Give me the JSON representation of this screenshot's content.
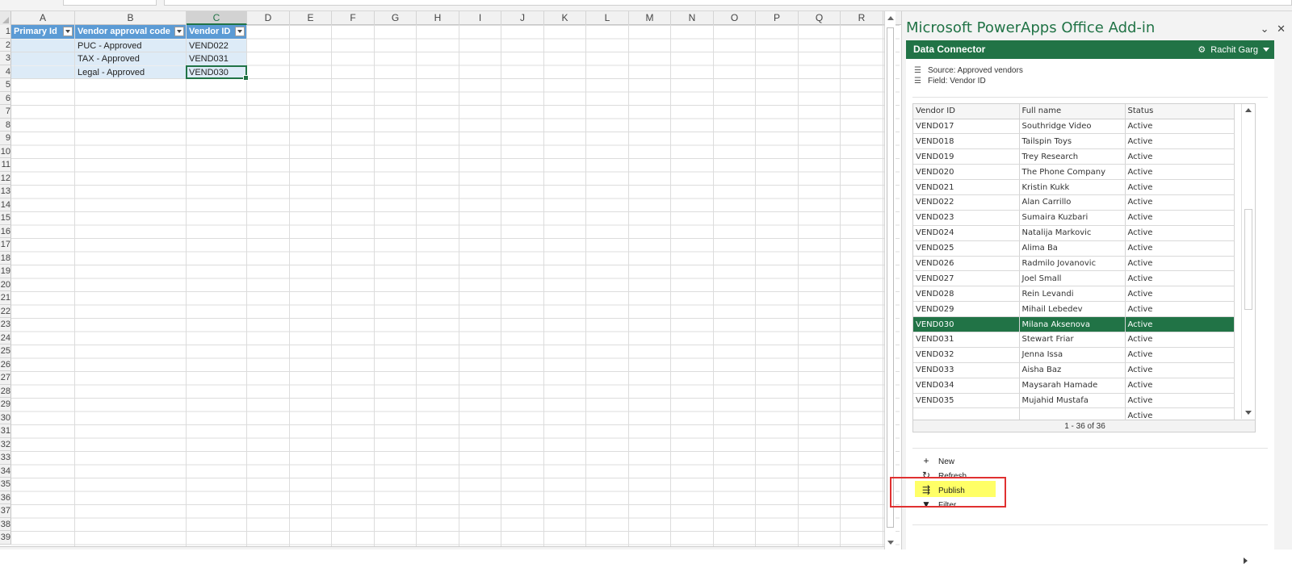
{
  "sheet": {
    "columns": [
      "A",
      "B",
      "C",
      "D",
      "E",
      "F",
      "G",
      "H",
      "I",
      "J",
      "K",
      "L",
      "M",
      "N",
      "O",
      "P",
      "Q",
      "R"
    ],
    "rows": [
      "1",
      "2",
      "3",
      "4",
      "5",
      "6",
      "7",
      "8",
      "9",
      "10",
      "11",
      "12",
      "13",
      "14",
      "15",
      "16",
      "17",
      "18",
      "19",
      "20",
      "21",
      "22",
      "23",
      "24",
      "25",
      "26",
      "27",
      "28",
      "29",
      "30",
      "31",
      "32",
      "33",
      "34",
      "35",
      "36",
      "37",
      "38",
      "39"
    ],
    "headers": [
      "Primary Id",
      "Vendor approval code",
      "Vendor ID"
    ],
    "data": [
      [
        "",
        "PUC - Approved",
        "VEND022"
      ],
      [
        "",
        "TAX - Approved",
        "VEND031"
      ],
      [
        "",
        "Legal - Approved",
        "VEND030"
      ]
    ]
  },
  "pane": {
    "title": "Microsoft PowerApps Office Add-in",
    "pin_icon": "pin-icon",
    "close_label": "✕",
    "pin_label": "⌄"
  },
  "connector": {
    "title": "Data Connector",
    "user": "Rachit Garg",
    "source": "Source: Approved vendors",
    "field": "Field: Vendor ID",
    "columns": [
      "Vendor ID",
      "Full name",
      "Status"
    ],
    "rows": [
      [
        "VEND017",
        "Southridge Video",
        "Active"
      ],
      [
        "VEND018",
        "Tailspin Toys",
        "Active"
      ],
      [
        "VEND019",
        "Trey Research",
        "Active"
      ],
      [
        "VEND020",
        "The Phone Company",
        "Active"
      ],
      [
        "VEND021",
        "Kristin Kukk",
        "Active"
      ],
      [
        "VEND022",
        "Alan Carrillo",
        "Active"
      ],
      [
        "VEND023",
        "Sumaira Kuzbari",
        "Active"
      ],
      [
        "VEND024",
        "Natalija Markovic",
        "Active"
      ],
      [
        "VEND025",
        "Alima Ba",
        "Active"
      ],
      [
        "VEND026",
        "Radmilo Jovanovic",
        "Active"
      ],
      [
        "VEND027",
        "Joel Small",
        "Active"
      ],
      [
        "VEND028",
        "Rein Levandi",
        "Active"
      ],
      [
        "VEND029",
        "Mihail Lebedev",
        "Active"
      ],
      [
        "VEND030",
        "Milana Aksenova",
        "Active"
      ],
      [
        "VEND031",
        "Stewart Friar",
        "Active"
      ],
      [
        "VEND032",
        "Jenna Issa",
        "Active"
      ],
      [
        "VEND033",
        "Aisha Baz",
        "Active"
      ],
      [
        "VEND034",
        "Maysarah Hamade",
        "Active"
      ],
      [
        "VEND035",
        "Mujahid Mustafa",
        "Active"
      ],
      [
        "",
        "",
        "Active"
      ]
    ],
    "selected_row": 13,
    "pager": "1 - 36 of 36"
  },
  "actions": {
    "new": "New",
    "refresh": "Refresh",
    "publish": "Publish",
    "filter": "Filter"
  },
  "colors": {
    "accent": "#217346",
    "table_header": "#5b9bd5",
    "band": "#ddebf7",
    "highlight": "#ffff66",
    "callout": "#e03030"
  }
}
